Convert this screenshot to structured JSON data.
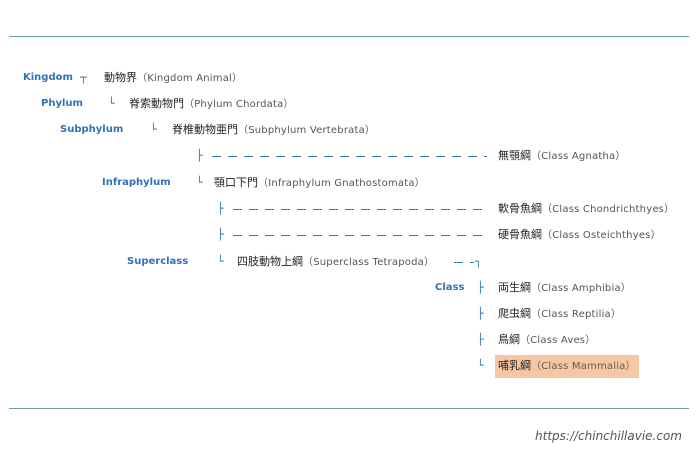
{
  "ranks": {
    "kingdom": "Kingdom",
    "phylum": "Phylum",
    "subphylum": "Subphylum",
    "infraphylum": "Infraphylum",
    "superclass": "Superclass",
    "class": "Class"
  },
  "nodes": {
    "animal": {
      "ja": "動物界",
      "en": "（Kingdom Animal）"
    },
    "chordata": {
      "ja": "脊索動物門",
      "en": "（Phylum Chordata）"
    },
    "vertebrata": {
      "ja": "脊椎動物亜門",
      "en": "（Subphylum Vertebrata）"
    },
    "agnatha": {
      "ja": "無顎綱",
      "en": "（Class Agnatha）"
    },
    "gnathostomata": {
      "ja": "顎口下門",
      "en": "（Infraphylum Gnathostomata）"
    },
    "chondrichthyes": {
      "ja": "軟骨魚綱",
      "en": "（Class Chondrichthyes）"
    },
    "osteichthyes": {
      "ja": "硬骨魚綱",
      "en": "（Class Osteichthyes）"
    },
    "tetrapoda": {
      "ja": "四肢動物上綱",
      "en": "（Superclass Tetrapoda）"
    },
    "amphibia": {
      "ja": "両生綱",
      "en": "（Class Amphibia）"
    },
    "reptilia": {
      "ja": "爬虫綱",
      "en": "（Class Reptilia）"
    },
    "aves": {
      "ja": "鳥綱",
      "en": "（Class Aves）"
    },
    "mammalia": {
      "ja": "哺乳綱",
      "en": "（Class Mammalia）"
    }
  },
  "colors": {
    "rank_text": "#2f73b7",
    "rule": "#6a9fa4",
    "highlight": "#f5c7a5"
  },
  "credit": "https://chinchillavie.com"
}
